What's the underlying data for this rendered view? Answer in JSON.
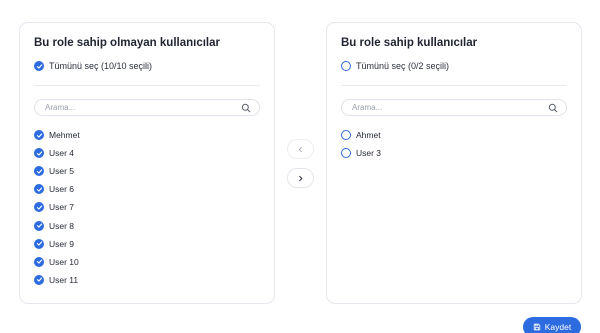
{
  "top_hint": "",
  "left_panel": {
    "title": "Bu role sahip olmayan kullanıcılar",
    "select_all_label": "Tümünü seç (10/10 seçili)",
    "select_all_checked": true,
    "search_placeholder": "Arama...",
    "users": [
      {
        "name": "Mehmet",
        "checked": true
      },
      {
        "name": "User 4",
        "checked": true
      },
      {
        "name": "User 5",
        "checked": true
      },
      {
        "name": "User 6",
        "checked": true
      },
      {
        "name": "User 7",
        "checked": true
      },
      {
        "name": "User 8",
        "checked": true
      },
      {
        "name": "User 9",
        "checked": true
      },
      {
        "name": "User 10",
        "checked": true
      },
      {
        "name": "User 11",
        "checked": true
      }
    ]
  },
  "right_panel": {
    "title": "Bu role sahip kullanıcılar",
    "select_all_label": "Tümünü seç (0/2 seçili)",
    "select_all_checked": false,
    "search_placeholder": "Arama...",
    "users": [
      {
        "name": "Ahmet",
        "checked": false
      },
      {
        "name": "User 3",
        "checked": false
      }
    ]
  },
  "transfer": {
    "move_left_icon": "chevron-left-icon",
    "move_right_icon": "chevron-right-icon"
  },
  "save_button": {
    "label": "Kaydet",
    "icon": "save-icon"
  },
  "colors": {
    "accent": "#2d6be0",
    "border": "#e4e7ec",
    "text": "#1f2430",
    "muted": "#9aa0ab"
  }
}
